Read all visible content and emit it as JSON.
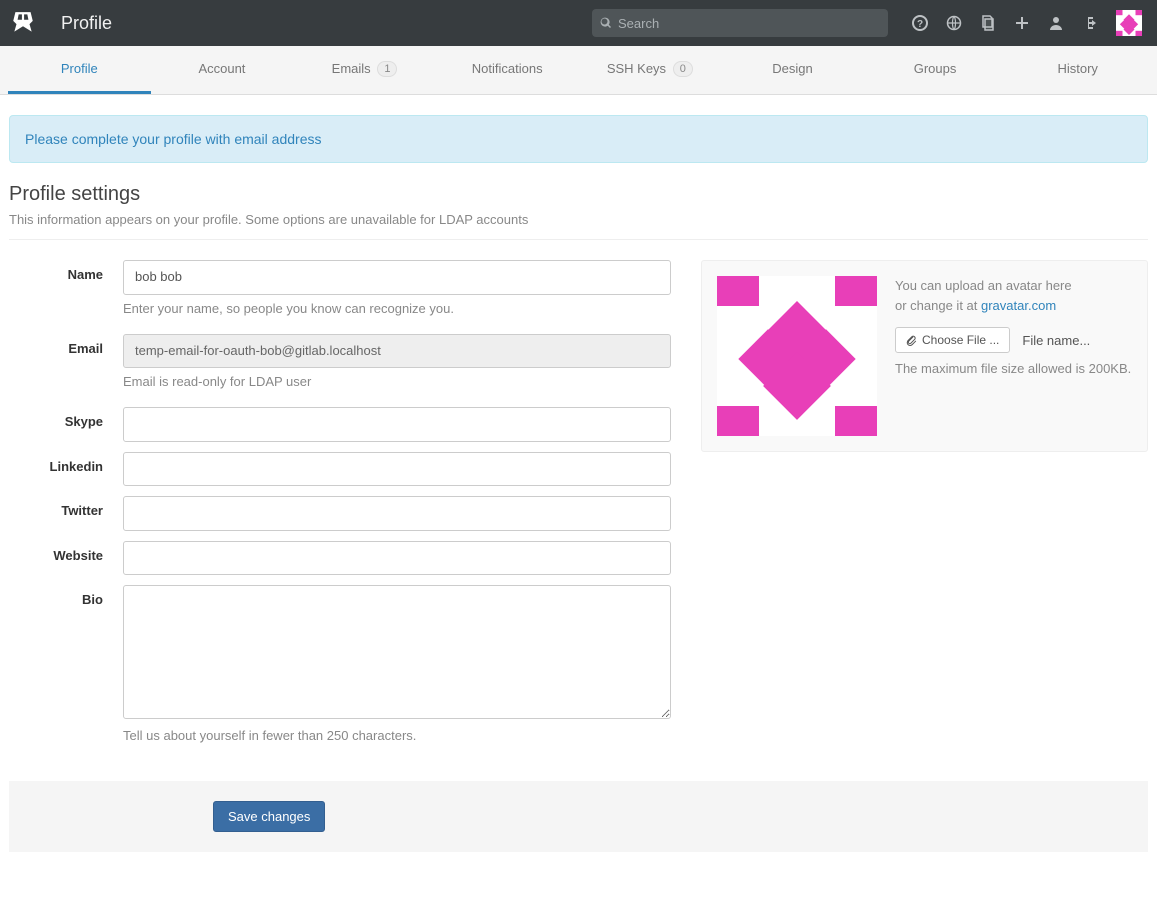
{
  "header": {
    "title": "Profile",
    "search_placeholder": "Search"
  },
  "tabs": [
    {
      "label": "Profile",
      "active": true
    },
    {
      "label": "Account"
    },
    {
      "label": "Emails",
      "badge": "1"
    },
    {
      "label": "Notifications"
    },
    {
      "label": "SSH Keys",
      "badge": "0"
    },
    {
      "label": "Design"
    },
    {
      "label": "Groups"
    },
    {
      "label": "History"
    }
  ],
  "alert": {
    "text": "Please complete your profile with email address"
  },
  "page": {
    "heading": "Profile settings",
    "subheading": "This information appears on your profile. Some options are unavailable for LDAP accounts"
  },
  "form": {
    "name": {
      "label": "Name",
      "value": "bob bob",
      "help": "Enter your name, so people you know can recognize you."
    },
    "email": {
      "label": "Email",
      "value": "temp-email-for-oauth-bob@gitlab.localhost",
      "help": "Email is read-only for LDAP user"
    },
    "skype": {
      "label": "Skype",
      "value": ""
    },
    "linkedin": {
      "label": "Linkedin",
      "value": ""
    },
    "twitter": {
      "label": "Twitter",
      "value": ""
    },
    "website": {
      "label": "Website",
      "value": ""
    },
    "bio": {
      "label": "Bio",
      "value": "",
      "help": "Tell us about yourself in fewer than 250 characters."
    },
    "save_label": "Save changes"
  },
  "side": {
    "upload_text": "You can upload an avatar here",
    "or_change_prefix": "or change it at ",
    "gravatar_label": "gravatar.com",
    "choose_file_label": "Choose File ...",
    "file_name_label": "File name...",
    "max_size_text": "The maximum file size allowed is 200KB."
  }
}
